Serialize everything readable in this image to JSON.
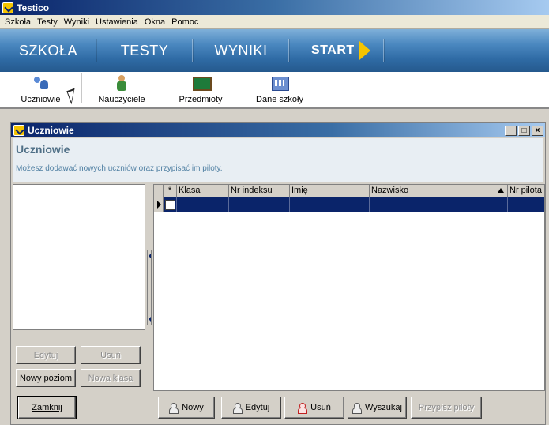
{
  "app": {
    "title": "Testico"
  },
  "menubar": [
    "Szkoła",
    "Testy",
    "Wyniki",
    "Ustawienia",
    "Okna",
    "Pomoc"
  ],
  "bignav": {
    "items": [
      "SZKOŁA",
      "TESTY",
      "WYNIKI"
    ],
    "start_label": "START"
  },
  "toolbar": {
    "items": [
      {
        "label": "Uczniowie",
        "icon": "students-icon"
      },
      {
        "label": "Nauczyciele",
        "icon": "teachers-icon"
      },
      {
        "label": "Przedmioty",
        "icon": "subjects-icon"
      },
      {
        "label": "Dane szkoły",
        "icon": "school-data-icon"
      }
    ]
  },
  "window": {
    "title": "Uczniowie",
    "header_title": "Uczniowie",
    "header_desc": "Możesz dodawać nowych uczniów oraz przypisać im piloty.",
    "controls": [
      "_",
      "□",
      "×"
    ]
  },
  "left_buttons": {
    "edit": "Edytuj",
    "delete": "Usuń",
    "new_level": "Nowy poziom",
    "new_class": "Nowa klasa"
  },
  "grid": {
    "columns": [
      "*",
      "Klasa",
      "Nr indeksu",
      "Imię",
      "Nazwisko",
      "Nr pilota"
    ],
    "sort_column": "Nazwisko",
    "rows": [
      {
        "klasa": "",
        "nr_indeksu": "",
        "imie": "",
        "nazwisko": "",
        "nr_pilota": ""
      }
    ]
  },
  "bottom_buttons": {
    "close": "Zamknij",
    "new": "Nowy",
    "edit": "Edytuj",
    "delete": "Usuń",
    "search": "Wyszukaj",
    "assign": "Przypisz piloty"
  },
  "colors": {
    "title_bar": "#0a246a",
    "nav_blue": "#2f6ba5",
    "start_arrow": "#f5c400",
    "selection": "#0a246a"
  }
}
